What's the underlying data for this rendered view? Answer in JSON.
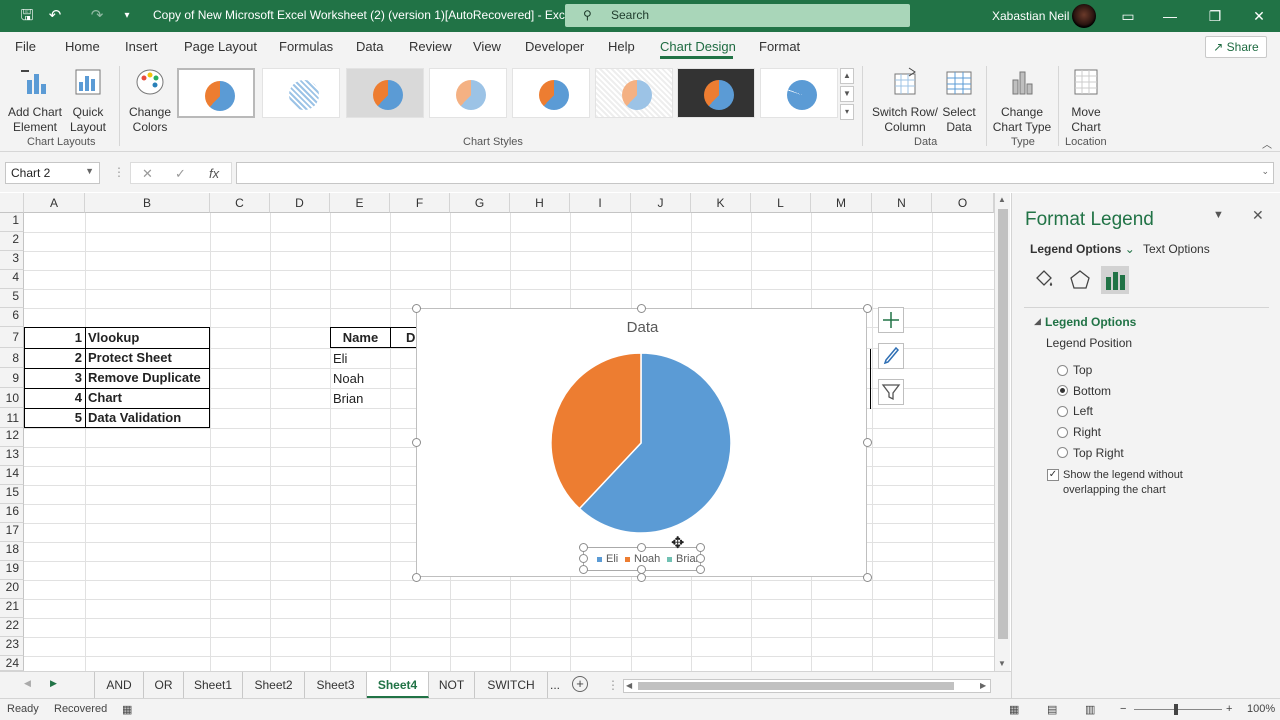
{
  "title_bar": {
    "save_icon": "save-icon",
    "undo_icon": "undo-icon",
    "redo_icon": "redo-icon",
    "doc_title": "Copy of New Microsoft Excel Worksheet (2) (version 1)[AutoRecovered]  -  Excel",
    "search_placeholder": "Search",
    "user_name": "Xabastian Neil",
    "accent": "#217346"
  },
  "menu": {
    "tabs": [
      "File",
      "Home",
      "Insert",
      "Page Layout",
      "Formulas",
      "Data",
      "Review",
      "View",
      "Developer",
      "Help",
      "Chart Design",
      "Format"
    ],
    "active_tab": "Chart Design",
    "share": "Share"
  },
  "ribbon": {
    "add_chart_element": "Add Chart Element",
    "quick_layout": "Quick Layout",
    "change_colors": "Change Colors",
    "group_chart_layouts": "Chart Layouts",
    "group_chart_styles": "Chart Styles",
    "switch_row_column": "Switch Row/ Column",
    "select_data": "Select Data",
    "group_data": "Data",
    "change_chart_type": "Change Chart Type",
    "group_type": "Type",
    "move_chart": "Move Chart",
    "group_location": "Location"
  },
  "formula_bar": {
    "name_box": "Chart 2",
    "fx": "fx",
    "cancel": "✕",
    "enter": "✓",
    "value": ""
  },
  "grid": {
    "columns": [
      "A",
      "B",
      "C",
      "D",
      "E",
      "F",
      "G",
      "H",
      "I",
      "J",
      "K",
      "L",
      "M",
      "N",
      "O"
    ],
    "rows": [
      "1",
      "2",
      "3",
      "4",
      "5",
      "6",
      "7",
      "8",
      "9",
      "10",
      "11",
      "12",
      "13",
      "14",
      "15",
      "16",
      "17",
      "18",
      "19",
      "20",
      "21",
      "22",
      "23",
      "24"
    ],
    "list_numbers": [
      "1",
      "2",
      "3",
      "4",
      "5"
    ],
    "list_items": [
      "Vlookup",
      "Protect Sheet",
      "Remove Duplicate",
      "Chart",
      "Data Validation"
    ],
    "table_header": "Name",
    "table_header_2": "D",
    "names": [
      "Eli",
      "Noah",
      "Brian"
    ]
  },
  "chart_data": {
    "type": "pie",
    "title": "Data",
    "categories": [
      "Eli",
      "Noah",
      "Brian"
    ],
    "values": [
      62,
      38,
      0
    ],
    "colors": [
      "#5b9bd5",
      "#ed7d31",
      "#a5a5a5"
    ],
    "legend_position": "bottom"
  },
  "pane": {
    "title": "Format Legend",
    "tab_options": "Legend Options",
    "tab_text": "Text Options",
    "section": "Legend Options",
    "position_label": "Legend Position",
    "positions": [
      "Top",
      "Bottom",
      "Left",
      "Right",
      "Top Right"
    ],
    "selected_position": "Bottom",
    "overlap_checkbox": "Show the legend without overlapping the chart",
    "overlap_checked": true
  },
  "sheets": {
    "tabs": [
      "AND",
      "OR",
      "Sheet1",
      "Sheet2",
      "Sheet3",
      "Sheet4",
      "NOT",
      "SWITCH"
    ],
    "active": "Sheet4",
    "more": "...",
    "add": "+"
  },
  "status": {
    "ready": "Ready",
    "recovered": "Recovered",
    "zoom": "100%"
  }
}
